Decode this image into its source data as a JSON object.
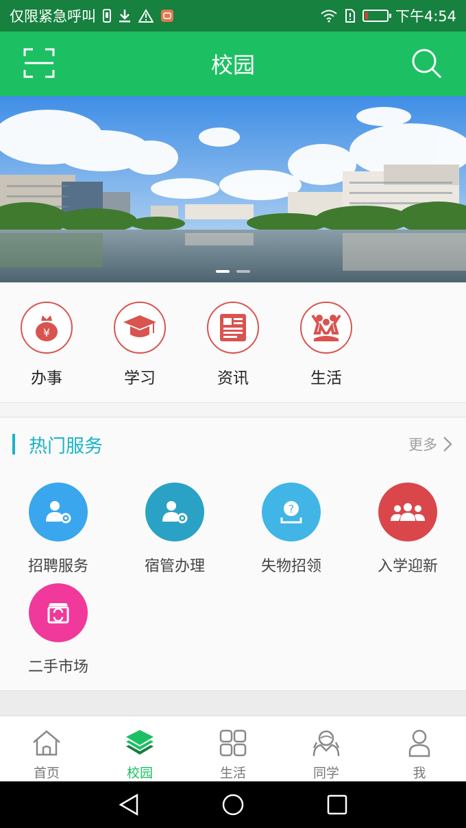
{
  "status_bar": {
    "left_text": "仅限紧急呼叫",
    "time": "下午4:54",
    "battery_level": 0.12
  },
  "header": {
    "title": "校园",
    "scan_icon": "scan-icon",
    "search_icon": "search-icon"
  },
  "banner": {
    "slides": 2,
    "active_slide": 1
  },
  "categories": [
    {
      "label": "办事",
      "icon": "money-bag-icon"
    },
    {
      "label": "学习",
      "icon": "graduation-cap-icon"
    },
    {
      "label": "资讯",
      "icon": "news-icon"
    },
    {
      "label": "生活",
      "icon": "people-cheer-icon"
    }
  ],
  "hot_services": {
    "title": "热门服务",
    "more_label": "更多",
    "items": [
      {
        "label": "招聘服务",
        "color": "#3aa6ee",
        "icon": "user-gear-icon"
      },
      {
        "label": "宿管办理",
        "color": "#2aa2c6",
        "icon": "user-gear-icon"
      },
      {
        "label": "失物招领",
        "color": "#40b5e6",
        "icon": "lost-found-icon"
      },
      {
        "label": "入学迎新",
        "color": "#d9474b",
        "icon": "group-icon"
      },
      {
        "label": "二手市场",
        "color": "#f0399a",
        "icon": "market-icon"
      }
    ]
  },
  "bottom_nav": {
    "items": [
      {
        "label": "首页",
        "icon": "home-icon"
      },
      {
        "label": "校园",
        "icon": "layers-icon",
        "active": true
      },
      {
        "label": "生活",
        "icon": "grid-icon"
      },
      {
        "label": "同学",
        "icon": "classmate-icon"
      },
      {
        "label": "我",
        "icon": "profile-icon"
      }
    ]
  },
  "colors": {
    "status_bar": "#17813f",
    "app_bar": "#1dbf63",
    "accent_teal": "#1ab3c6",
    "category_red": "#d9534f"
  }
}
